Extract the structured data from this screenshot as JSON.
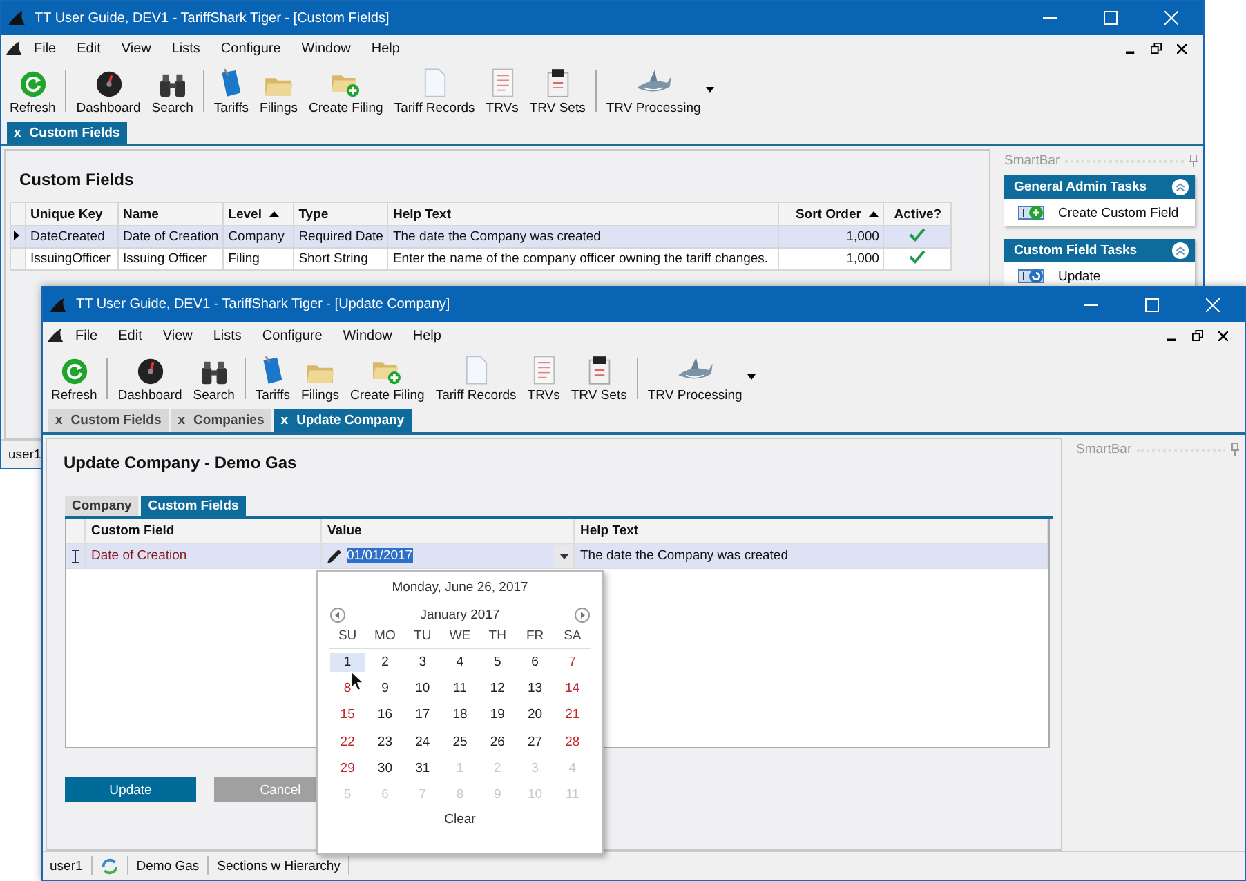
{
  "back_window": {
    "title": "TT User Guide, DEV1 - TariffShark Tiger - [Custom Fields]",
    "menu": [
      "File",
      "Edit",
      "View",
      "Lists",
      "Configure",
      "Window",
      "Help"
    ],
    "toolbar": [
      {
        "items": [
          {
            "label": "Refresh",
            "dropdown": false
          }
        ]
      },
      {
        "items": [
          {
            "label": "Dashboard",
            "dropdown": false
          },
          {
            "label": "Search",
            "dropdown": false
          }
        ]
      },
      {
        "items": [
          {
            "label": "Tariffs",
            "dropdown": false
          },
          {
            "label": "Filings",
            "dropdown": false
          },
          {
            "label": "Create Filing",
            "dropdown": false
          },
          {
            "label": "Tariff Records",
            "dropdown": false
          },
          {
            "label": "TRVs",
            "dropdown": false
          },
          {
            "label": "TRV Sets",
            "dropdown": false
          }
        ]
      },
      {
        "items": [
          {
            "label": "TRV Processing",
            "dropdown": true
          }
        ]
      }
    ],
    "tabs": [
      {
        "close": "x",
        "label": "Custom Fields",
        "selected": true
      }
    ],
    "heading": "Custom Fields",
    "table": {
      "columns": [
        {
          "label": "Unique Key",
          "sorted": false
        },
        {
          "label": "Name",
          "sorted": false
        },
        {
          "label": "Level",
          "sorted": true
        },
        {
          "label": "Type",
          "sorted": false
        },
        {
          "label": "Help Text",
          "sorted": false
        },
        {
          "label": "Sort Order",
          "sorted": true
        },
        {
          "label": "Active?",
          "sorted": false
        }
      ],
      "rows": [
        {
          "selected": true,
          "cells": [
            "DateCreated",
            "Date of Creation",
            "Company",
            "Required Date",
            "The date the Company was created",
            "1,000"
          ],
          "active": true
        },
        {
          "selected": false,
          "cells": [
            "IssuingOfficer",
            "Issuing Officer",
            "Filing",
            "Short String",
            "Enter the name of the company officer owning the tariff changes.",
            "1,000"
          ],
          "active": true
        }
      ]
    },
    "smartbar": {
      "title": "SmartBar",
      "panels": [
        {
          "title": "General Admin Tasks",
          "items": [
            "Create Custom Field"
          ]
        },
        {
          "title": "Custom Field Tasks",
          "items": [
            "Update"
          ]
        }
      ]
    },
    "status_bar": [
      "user1"
    ]
  },
  "front_window": {
    "title": "TT User Guide, DEV1 - TariffShark Tiger - [Update Company]",
    "menu": [
      "File",
      "Edit",
      "View",
      "Lists",
      "Configure",
      "Window",
      "Help"
    ],
    "toolbar": [
      {
        "items": [
          {
            "label": "Refresh",
            "dropdown": false
          }
        ]
      },
      {
        "items": [
          {
            "label": "Dashboard",
            "dropdown": false
          },
          {
            "label": "Search",
            "dropdown": false
          }
        ]
      },
      {
        "items": [
          {
            "label": "Tariffs",
            "dropdown": false
          },
          {
            "label": "Filings",
            "dropdown": false
          },
          {
            "label": "Create Filing",
            "dropdown": false
          },
          {
            "label": "Tariff Records",
            "dropdown": false
          },
          {
            "label": "TRVs",
            "dropdown": false
          },
          {
            "label": "TRV Sets",
            "dropdown": false
          }
        ]
      },
      {
        "items": [
          {
            "label": "TRV Processing",
            "dropdown": true
          }
        ]
      }
    ],
    "tabs": [
      {
        "close": "x",
        "label": "Custom Fields",
        "selected": false
      },
      {
        "close": "x",
        "label": "Companies",
        "selected": false
      },
      {
        "close": "x",
        "label": "Update Company",
        "selected": true
      }
    ],
    "heading": "Update Company - Demo Gas",
    "inner_tabs": [
      {
        "label": "Company",
        "selected": false
      },
      {
        "label": "Custom Fields",
        "selected": true
      }
    ],
    "grid": {
      "columns": [
        "Custom Field",
        "Value",
        "Help Text"
      ],
      "rows": [
        {
          "editing": true,
          "field": "Date of Creation",
          "value": "01/01/2017",
          "help": "The date the Company was created"
        }
      ]
    },
    "buttons": [
      {
        "label": "Update",
        "kind": "primary"
      },
      {
        "label": "Cancel",
        "kind": "secondary"
      }
    ],
    "smartbar": {
      "title": "SmartBar"
    },
    "status_bar": [
      "user1",
      "Demo Gas",
      "Sections w Hierarchy"
    ],
    "date_picker": {
      "today": "Monday, June 26, 2017",
      "month": "January 2017",
      "weekdays": [
        "SU",
        "MO",
        "TU",
        "WE",
        "TH",
        "FR",
        "SA"
      ],
      "weeks": [
        [
          {
            "label": "1",
            "kind": "weekend",
            "selected": true
          },
          {
            "label": "2",
            "kind": "day",
            "selected": false
          },
          {
            "label": "3",
            "kind": "day",
            "selected": false
          },
          {
            "label": "4",
            "kind": "day",
            "selected": false
          },
          {
            "label": "5",
            "kind": "day",
            "selected": false
          },
          {
            "label": "6",
            "kind": "day",
            "selected": false
          },
          {
            "label": "7",
            "kind": "weekend",
            "selected": false
          }
        ],
        [
          {
            "label": "8",
            "kind": "weekend",
            "selected": false
          },
          {
            "label": "9",
            "kind": "day",
            "selected": false
          },
          {
            "label": "10",
            "kind": "day",
            "selected": false
          },
          {
            "label": "11",
            "kind": "day",
            "selected": false
          },
          {
            "label": "12",
            "kind": "day",
            "selected": false
          },
          {
            "label": "13",
            "kind": "day",
            "selected": false
          },
          {
            "label": "14",
            "kind": "weekend",
            "selected": false
          }
        ],
        [
          {
            "label": "15",
            "kind": "weekend",
            "selected": false
          },
          {
            "label": "16",
            "kind": "day",
            "selected": false
          },
          {
            "label": "17",
            "kind": "day",
            "selected": false
          },
          {
            "label": "18",
            "kind": "day",
            "selected": false
          },
          {
            "label": "19",
            "kind": "day",
            "selected": false
          },
          {
            "label": "20",
            "kind": "day",
            "selected": false
          },
          {
            "label": "21",
            "kind": "weekend",
            "selected": false
          }
        ],
        [
          {
            "label": "22",
            "kind": "weekend",
            "selected": false
          },
          {
            "label": "23",
            "kind": "day",
            "selected": false
          },
          {
            "label": "24",
            "kind": "day",
            "selected": false
          },
          {
            "label": "25",
            "kind": "day",
            "selected": false
          },
          {
            "label": "26",
            "kind": "day",
            "selected": false
          },
          {
            "label": "27",
            "kind": "day",
            "selected": false
          },
          {
            "label": "28",
            "kind": "weekend",
            "selected": false
          }
        ],
        [
          {
            "label": "29",
            "kind": "weekend",
            "selected": false
          },
          {
            "label": "30",
            "kind": "day",
            "selected": false
          },
          {
            "label": "31",
            "kind": "day",
            "selected": false
          },
          {
            "label": "1",
            "kind": "other",
            "selected": false
          },
          {
            "label": "2",
            "kind": "other",
            "selected": false
          },
          {
            "label": "3",
            "kind": "other",
            "selected": false
          },
          {
            "label": "4",
            "kind": "other",
            "selected": false
          }
        ],
        [
          {
            "label": "5",
            "kind": "other",
            "selected": false
          },
          {
            "label": "6",
            "kind": "other",
            "selected": false
          },
          {
            "label": "7",
            "kind": "other",
            "selected": false
          },
          {
            "label": "8",
            "kind": "other",
            "selected": false
          },
          {
            "label": "9",
            "kind": "other",
            "selected": false
          },
          {
            "label": "10",
            "kind": "other",
            "selected": false
          },
          {
            "label": "11",
            "kind": "other",
            "selected": false
          }
        ]
      ],
      "clear": "Clear"
    }
  }
}
